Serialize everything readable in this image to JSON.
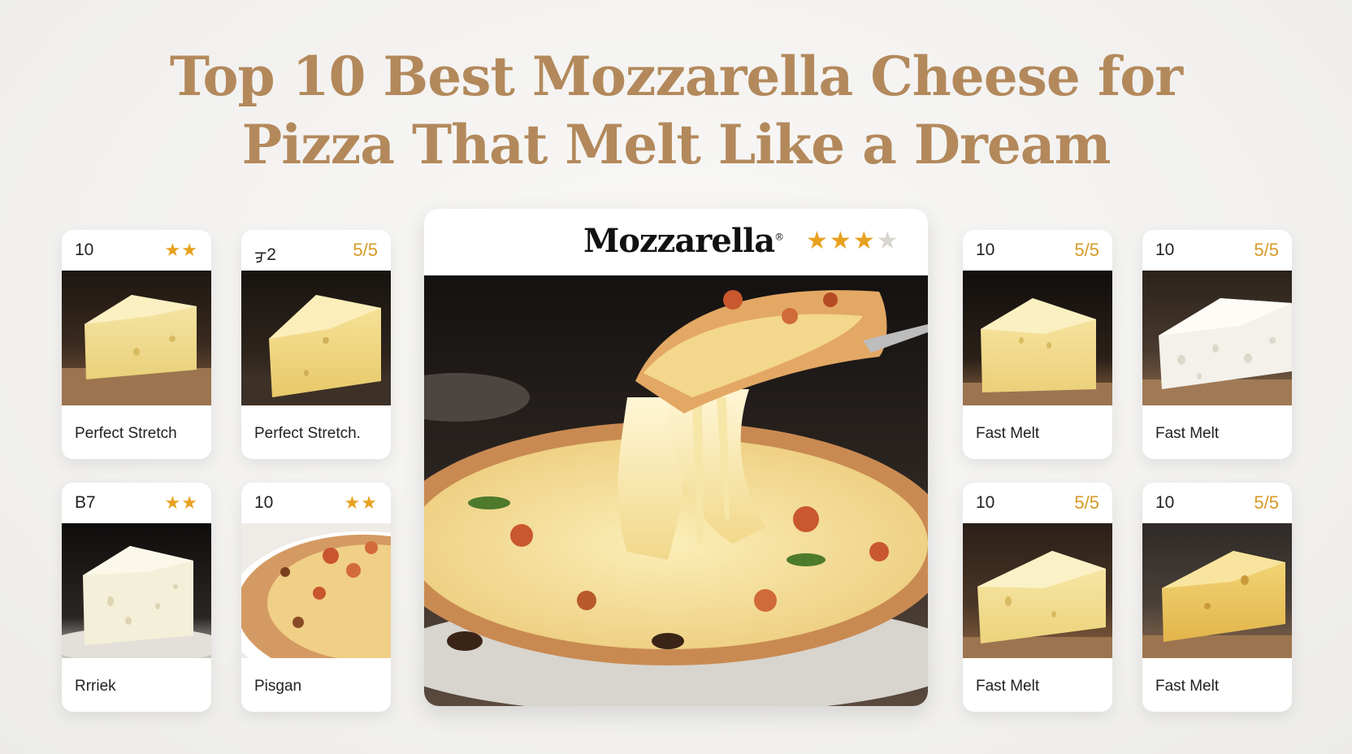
{
  "title": {
    "line1": "Top 10 Best Mozzarella Cheese for",
    "line2": "Pizza That Melt Like a Dream"
  },
  "feature": {
    "brand": "Mozzarella",
    "registered_mark": "®",
    "rating_stars": 3,
    "rating_max": 4,
    "image": "pizza-cheese-pull"
  },
  "cards": [
    {
      "number": "10",
      "rating_text": "★★",
      "label": "Perfect Stretch",
      "image": "cheese-wedge"
    },
    {
      "number": "ᢖ2",
      "rating_text": "5/5",
      "label": "Perfect Stretch.",
      "image": "cheese-wedge"
    },
    {
      "number": "B7",
      "rating_text": "★★",
      "label": "Rrriek",
      "image": "white-cheese-wedge"
    },
    {
      "number": "10",
      "rating_text": "★★",
      "label": "Pisgan",
      "image": "pizza-crust"
    },
    {
      "number": "10",
      "rating_text": "5/5",
      "label": "Fast Melt",
      "image": "cheese-wedge"
    },
    {
      "number": "10",
      "rating_text": "5/5",
      "label": "Fast Melt",
      "image": "white-cheese-wedge"
    },
    {
      "number": "10",
      "rating_text": "5/5",
      "label": "Fast Melt",
      "image": "cheese-wedge"
    },
    {
      "number": "10",
      "rating_text": "5/5",
      "label": "Fast Melt",
      "image": "aged-cheese-wedge"
    }
  ],
  "colors": {
    "title": "#b3895c",
    "star": "#e7a11f",
    "score": "#d69a26",
    "background": "#f4f3f1"
  }
}
